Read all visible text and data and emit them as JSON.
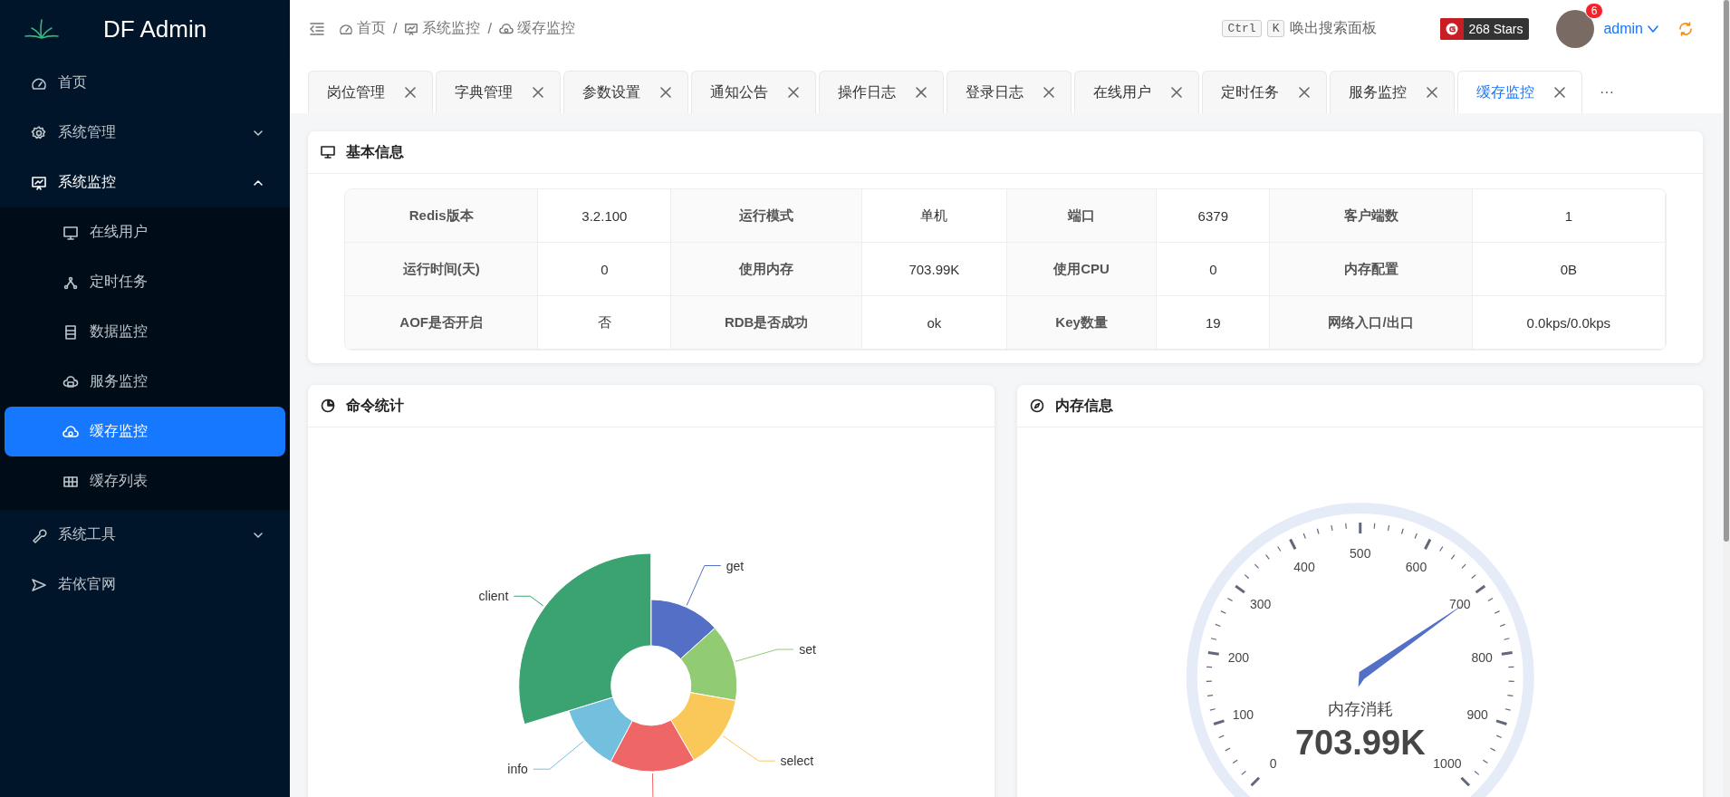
{
  "sidebar": {
    "logo_text": "DF Admin",
    "items": [
      {
        "label": "首页",
        "selected": false
      },
      {
        "label": "系统管理",
        "selected": false,
        "expanded": false
      },
      {
        "label": "系统监控",
        "selected": false,
        "expanded": true,
        "children": [
          {
            "label": "在线用户",
            "selected": false
          },
          {
            "label": "定时任务",
            "selected": false
          },
          {
            "label": "数据监控",
            "selected": false
          },
          {
            "label": "服务监控",
            "selected": false
          },
          {
            "label": "缓存监控",
            "selected": true
          },
          {
            "label": "缓存列表",
            "selected": false
          }
        ]
      },
      {
        "label": "系统工具",
        "selected": false,
        "expanded": false
      },
      {
        "label": "若依官网",
        "selected": false
      }
    ]
  },
  "header": {
    "breadcrumb": [
      "首页",
      "系统监控",
      "缓存监控"
    ],
    "separator": "/",
    "search_keys": [
      "Ctrl",
      "K"
    ],
    "search_label": "唤出搜索面板",
    "stars_badge": "268 Stars",
    "notification_count": "6",
    "user_name": "admin"
  },
  "tabs": [
    {
      "label": "岗位管理",
      "selected": false
    },
    {
      "label": "字典管理",
      "selected": false
    },
    {
      "label": "参数设置",
      "selected": false
    },
    {
      "label": "通知公告",
      "selected": false
    },
    {
      "label": "操作日志",
      "selected": false
    },
    {
      "label": "登录日志",
      "selected": false
    },
    {
      "label": "在线用户",
      "selected": false
    },
    {
      "label": "定时任务",
      "selected": false
    },
    {
      "label": "服务监控",
      "selected": false
    },
    {
      "label": "缓存监控",
      "selected": true
    }
  ],
  "tabs_more": "···",
  "basic_info": {
    "title": "基本信息",
    "rows": [
      [
        {
          "label": "Redis版本",
          "value": "3.2.100"
        },
        {
          "label": "运行模式",
          "value": "单机"
        },
        {
          "label": "端口",
          "value": "6379"
        },
        {
          "label": "客户端数",
          "value": "1"
        }
      ],
      [
        {
          "label": "运行时间(天)",
          "value": "0"
        },
        {
          "label": "使用内存",
          "value": "703.99K"
        },
        {
          "label": "使用CPU",
          "value": "0"
        },
        {
          "label": "内存配置",
          "value": "0B"
        }
      ],
      [
        {
          "label": "AOF是否开启",
          "value": "否"
        },
        {
          "label": "RDB是否成功",
          "value": "ok"
        },
        {
          "label": "Key数量",
          "value": "19"
        },
        {
          "label": "网络入口/出口",
          "value": "0.0kps/0.0kps"
        }
      ]
    ]
  },
  "command_stats": {
    "title": "命令统计",
    "slices": [
      {
        "label": "get",
        "color": "#5470c6",
        "kind": "normal"
      },
      {
        "label": "set",
        "color": "#91cc75",
        "kind": "normal"
      },
      {
        "label": "select",
        "color": "#fac858",
        "kind": "normal"
      },
      {
        "color": "#ee6666",
        "kind": "normal"
      },
      {
        "label": "info",
        "color": "#73c0de",
        "kind": "normal"
      },
      {
        "label": "client",
        "color": "#3ba272",
        "kind": "large"
      }
    ]
  },
  "memory_info": {
    "title": "内存信息",
    "gauge": {
      "level": 0.704,
      "ticks": [
        "0",
        "100",
        "200",
        "300",
        "400",
        "500",
        "600",
        "700",
        "800",
        "900",
        "1000"
      ],
      "detail_label": "内存消耗",
      "value": "703.99K"
    }
  }
}
